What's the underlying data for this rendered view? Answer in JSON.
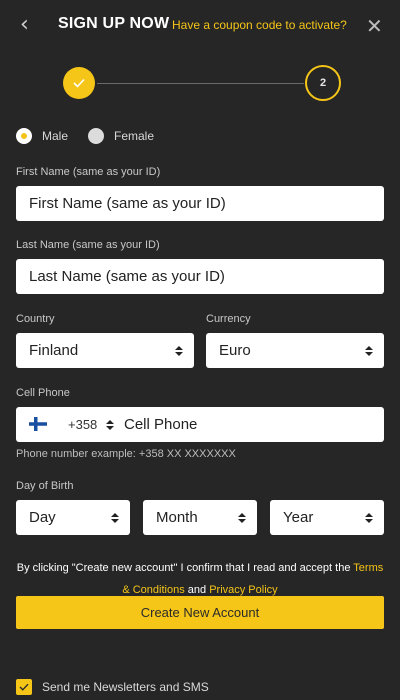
{
  "header": {
    "back_icon": "chevron-left-icon",
    "title": "SIGN UP NOW",
    "coupon_link": "Have a coupon code to activate?",
    "close_icon": "close-icon"
  },
  "stepper": {
    "step1_icon": "check-icon",
    "step2_label": "2"
  },
  "gender": {
    "options": [
      {
        "label": "Male",
        "selected": true
      },
      {
        "label": "Female",
        "selected": false
      }
    ]
  },
  "first_name": {
    "label": "First Name (same as your ID)",
    "placeholder": "First Name  (same as your ID)"
  },
  "last_name": {
    "label": "Last Name (same as your ID)",
    "placeholder": "Last Name (same as your ID)"
  },
  "country": {
    "label": "Country",
    "value": "Finland"
  },
  "currency": {
    "label": "Currency",
    "value": "Euro"
  },
  "cell_phone": {
    "label": "Cell Phone",
    "flag_icon": "finland-flag-icon",
    "code": "+358",
    "placeholder": "Cell Phone",
    "hint": "Phone number example: +358 XX XXXXXXX"
  },
  "birth": {
    "label": "Day of Birth",
    "day": "Day",
    "month": "Month",
    "year": "Year"
  },
  "consent": {
    "text_before": "By clicking \"Create new account\" I confirm that I read and accept the ",
    "terms_link": "Terms & Conditions",
    "and_text": " and ",
    "privacy_link": "Privacy Policy"
  },
  "cta": {
    "label": "Create New Account"
  },
  "newsletter": {
    "label": "Send me Newsletters and SMS",
    "checked": true
  },
  "colors": {
    "background": "#262626",
    "accent": "#f5c518",
    "field_bg": "#ffffff"
  }
}
